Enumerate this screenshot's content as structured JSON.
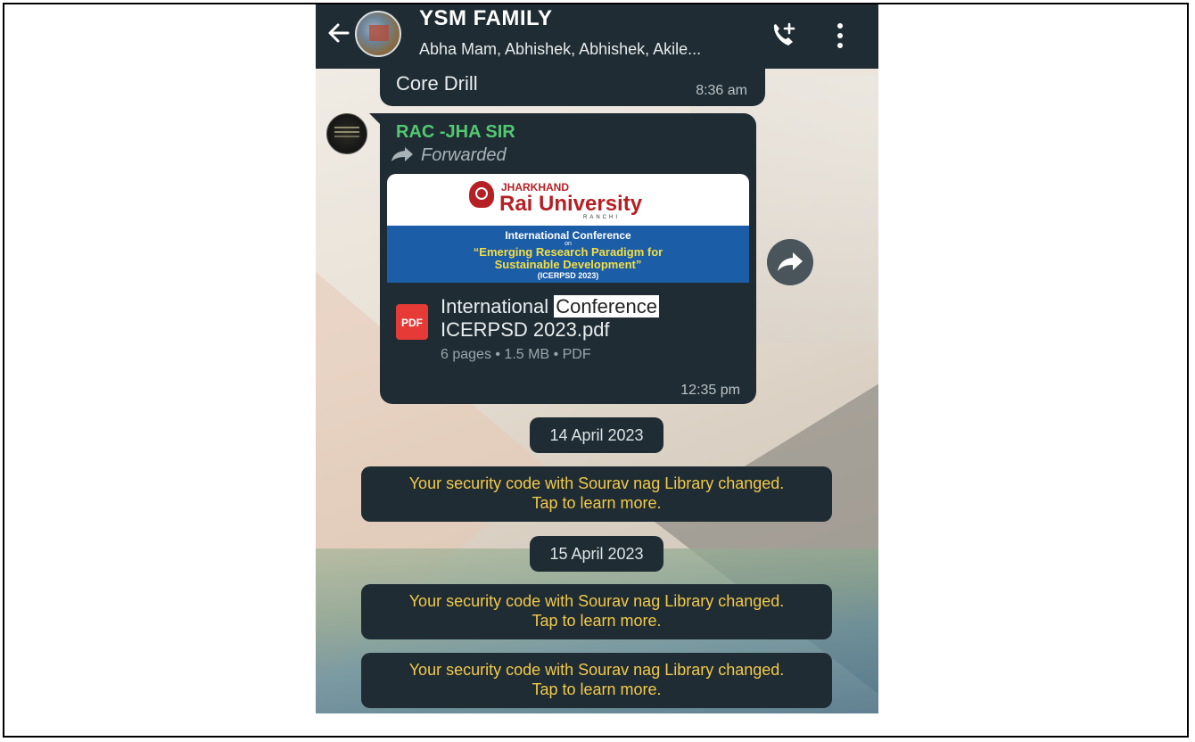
{
  "header": {
    "title": "YSM  FAMILY",
    "members": "Abha Mam, Abhishek, Abhishek, Akile..."
  },
  "messages": {
    "core_drill": {
      "text": "Core Drill",
      "time": "8:36 am"
    },
    "forward_msg": {
      "sender": "RAC -JHA SIR",
      "forwarded_label": "Forwarded",
      "preview": {
        "logo_line1": "JHARKHAND",
        "logo_line2": "Rai University",
        "logo_line3": "RANCHI",
        "conf_line1": "International  Conference",
        "conf_on": "on",
        "conf_line2": "“Emerging Research Paradigm for",
        "conf_line3": "Sustainable Development”",
        "conf_line4": "(ICERPSD 2023)"
      },
      "file": {
        "icon_label": "PDF",
        "name_part1": "International ",
        "name_highlight": "Conference",
        "name_line2": "ICERPSD 2023.pdf",
        "meta": "6 pages • 1.5 MB • PDF"
      },
      "time": "12:35 pm"
    }
  },
  "dates": [
    "14 April 2023",
    "15 April 2023"
  ],
  "system_notices": [
    {
      "line1": "Your security code with Sourav nag Library changed.",
      "line2": "Tap to learn more."
    },
    {
      "line1": "Your security code with Sourav nag Library changed.",
      "line2": "Tap to learn more."
    },
    {
      "line1": "Your security code with Sourav nag Library changed.",
      "line2": "Tap to learn more."
    }
  ],
  "colors": {
    "header_bg": "#1f2c33",
    "sender_name": "#53c872",
    "notice_text": "#f2c94c",
    "pdf_icon": "#e53a35"
  },
  "icons": {
    "back": "arrow-left-icon",
    "call": "add-call-icon",
    "menu": "more-vertical-icon",
    "forward": "forward-arrow-icon",
    "share": "share-forward-icon"
  }
}
